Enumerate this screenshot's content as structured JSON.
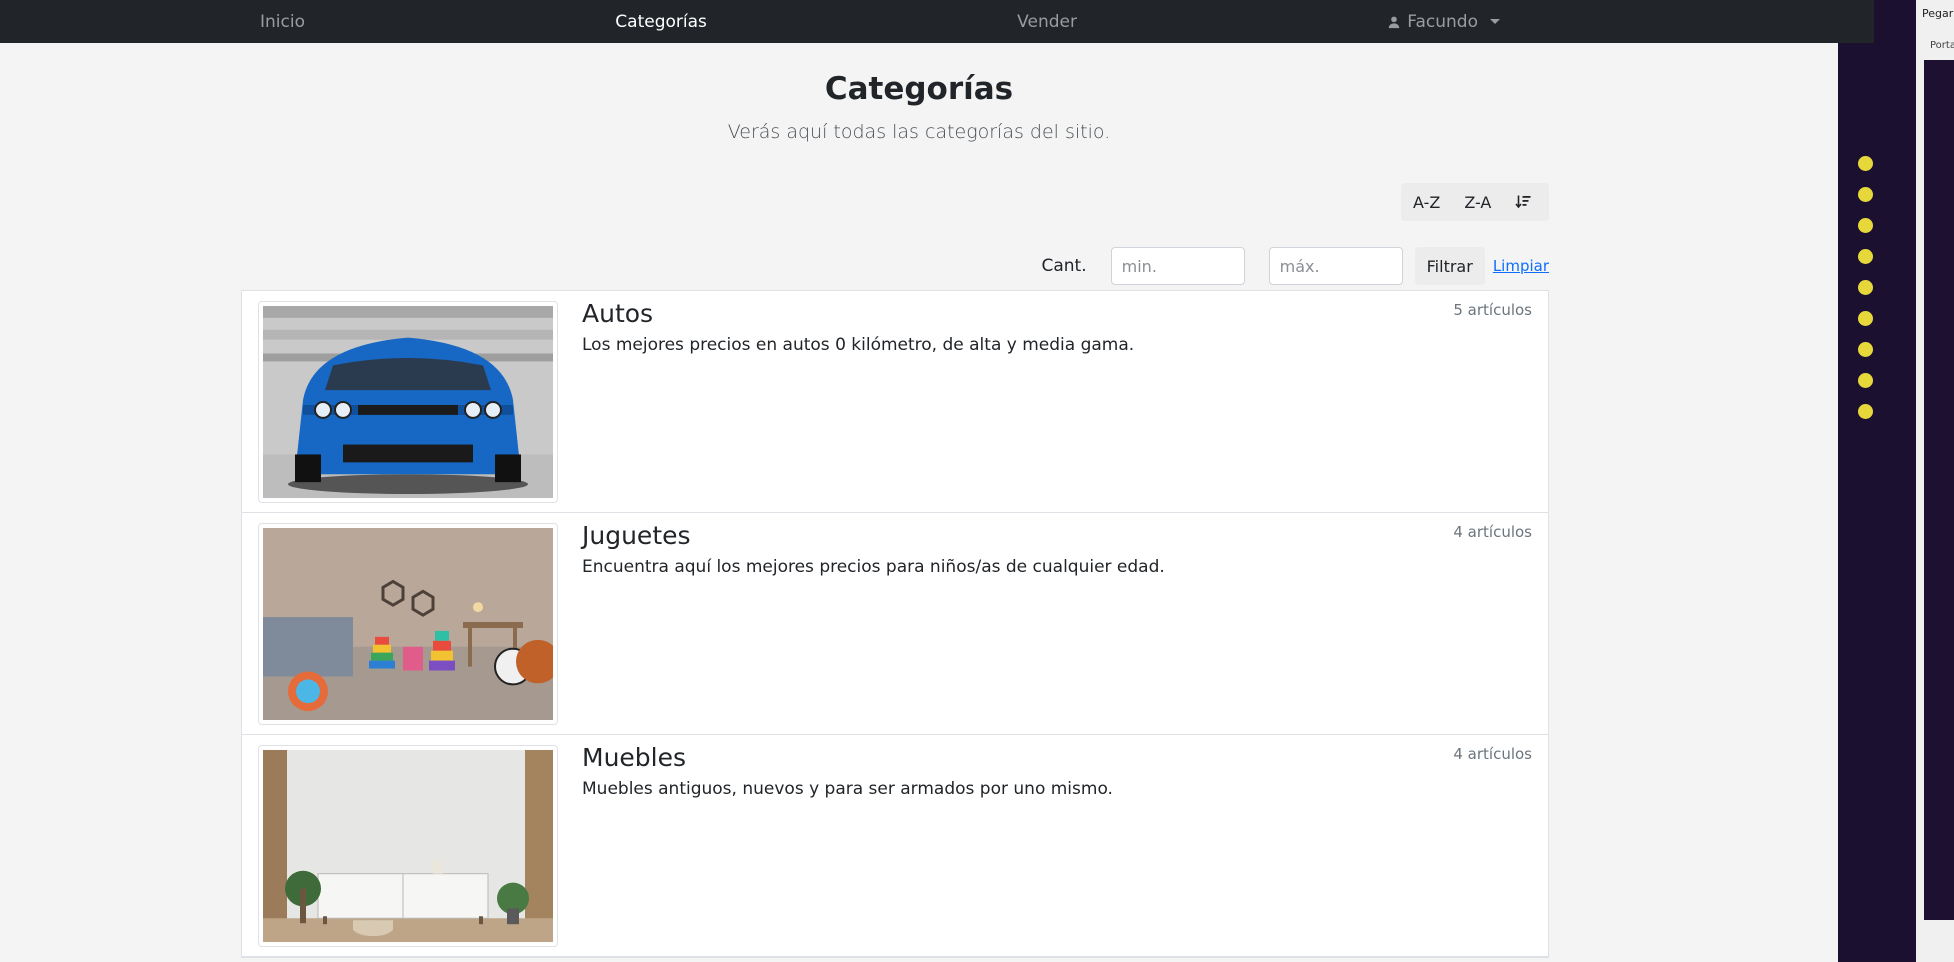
{
  "nav": {
    "items": [
      {
        "label": "Inicio",
        "active": false
      },
      {
        "label": "Categorías",
        "active": true
      },
      {
        "label": "Vender",
        "active": false
      }
    ],
    "user": "Facundo"
  },
  "header": {
    "title": "Categorías",
    "subtitle": "Verás aquí todas las categorías del sitio."
  },
  "sort": {
    "az_label": "A-Z",
    "za_label": "Z-A",
    "count_icon": "sort-count-icon"
  },
  "filter": {
    "label": "Cant.",
    "min_placeholder": "min.",
    "max_placeholder": "máx.",
    "filter_label": "Filtrar",
    "clear_label": "Limpiar"
  },
  "categories": [
    {
      "name": "Autos",
      "description": "Los mejores precios en autos 0 kilómetro, de alta y media gama.",
      "count": "5 artículos"
    },
    {
      "name": "Juguetes",
      "description": "Encuentra aquí los mejores precios para niños/as de cualquier edad.",
      "count": "4 artículos"
    },
    {
      "name": "Muebles",
      "description": "Muebles antiguos, nuevos y para ser armados por uno mismo.",
      "count": "4 artículos"
    }
  ],
  "side": {
    "pegar": "Pegar",
    "porta": "Porta"
  },
  "colors": {
    "navbar": "#212529",
    "page_bg": "#f4f4f4",
    "link": "#0d6efd",
    "accent_dots": "#e6d83a"
  }
}
